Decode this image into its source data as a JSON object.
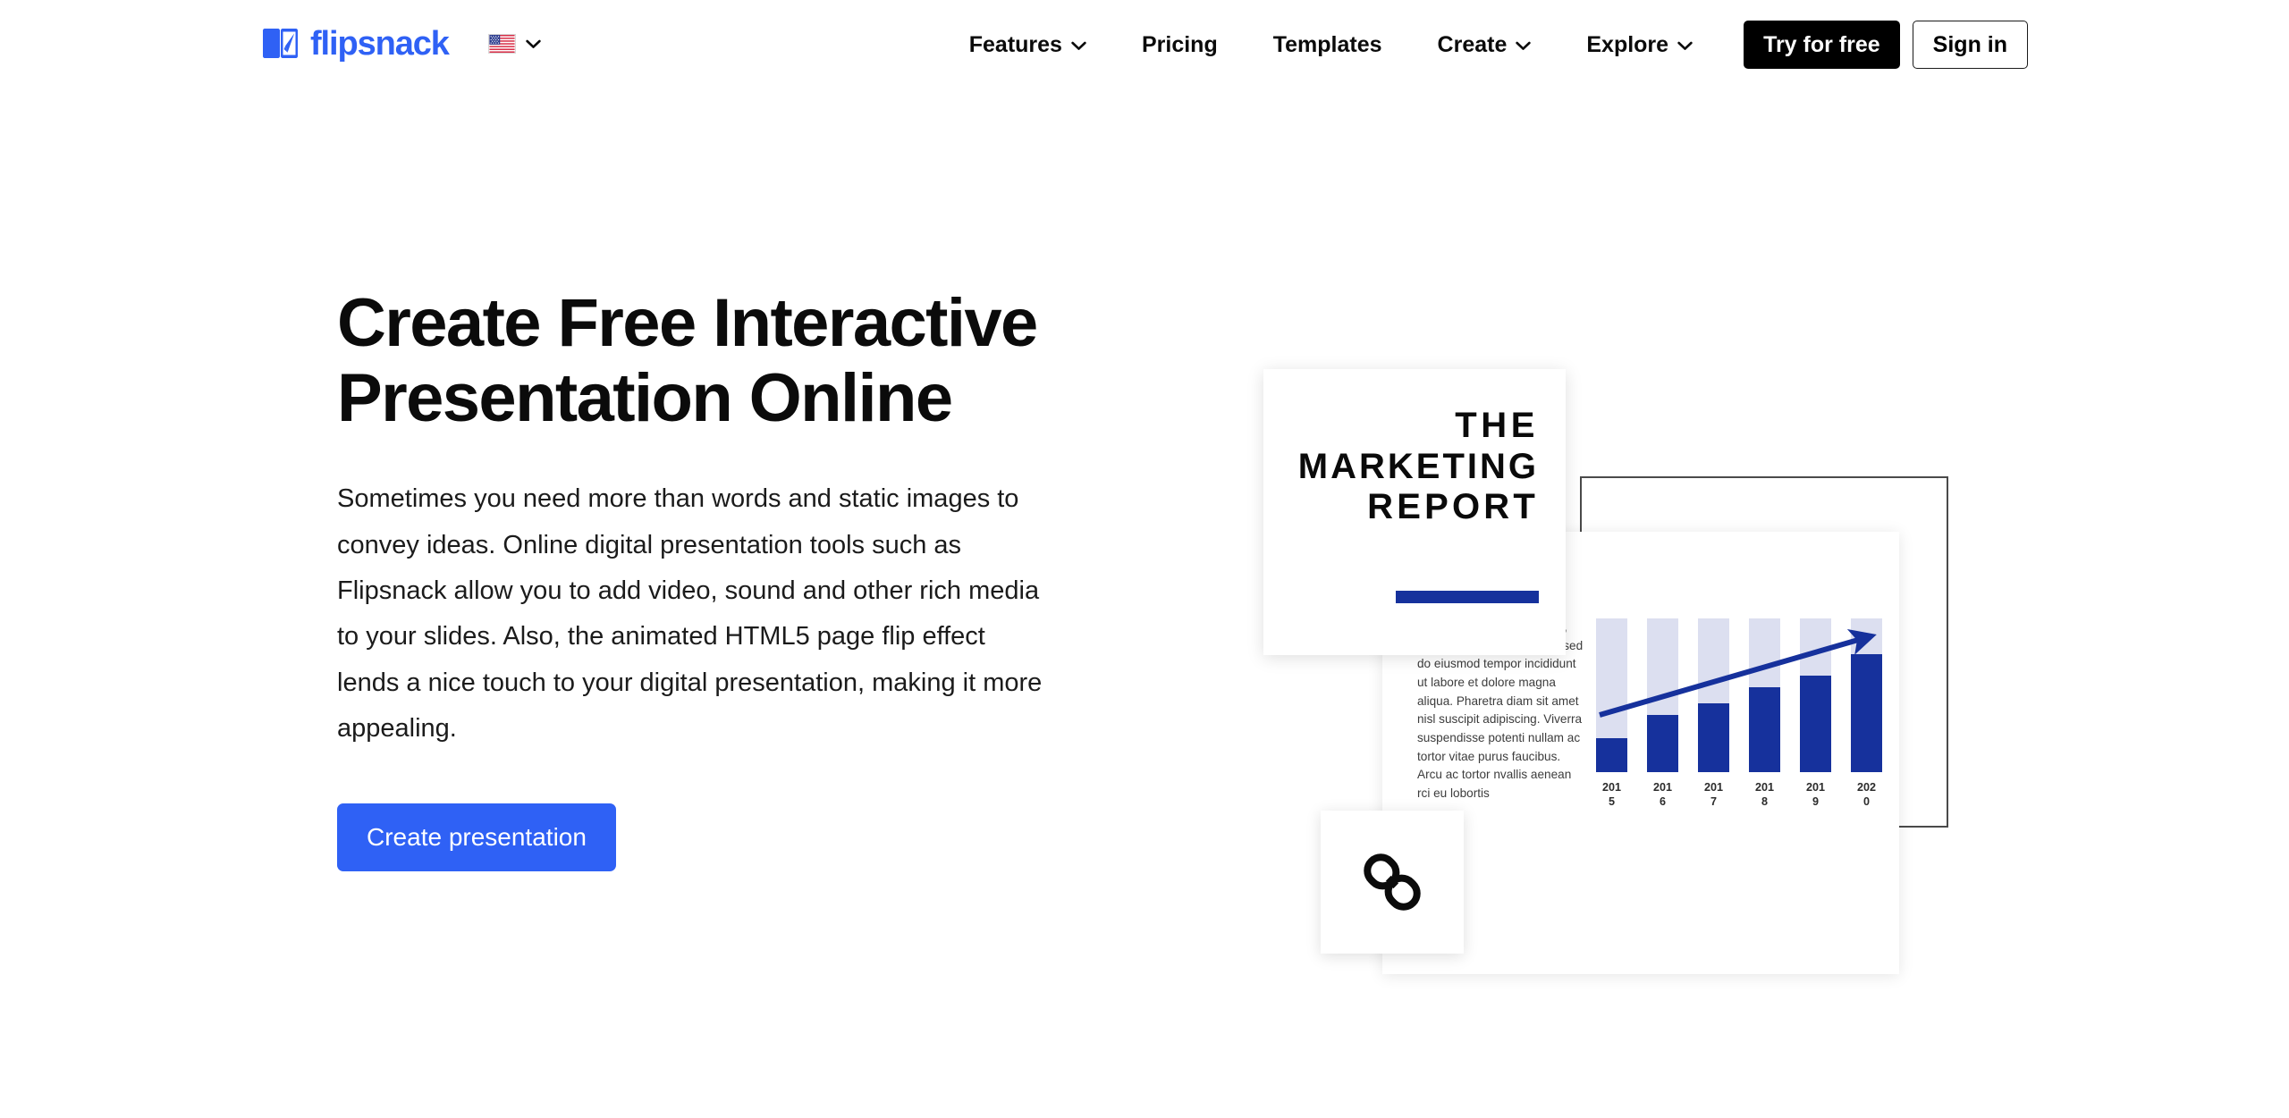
{
  "header": {
    "logo": {
      "icon": "flipsnack-book-icon",
      "wordmark": "flipsnack",
      "color": "#2f61f5"
    },
    "language_switcher": {
      "flag": "us-flag-icon",
      "chevron": "chevron-down-icon"
    },
    "nav_items": [
      {
        "label": "Features",
        "has_dropdown": true
      },
      {
        "label": "Pricing",
        "has_dropdown": false
      },
      {
        "label": "Templates",
        "has_dropdown": false
      },
      {
        "label": "Create",
        "has_dropdown": true
      },
      {
        "label": "Explore",
        "has_dropdown": true
      }
    ],
    "try_button": "Try for free",
    "signin_button": "Sign in"
  },
  "hero": {
    "title": "Create Free Interactive Presentation Online",
    "body": "Sometimes you need more than words and static images to convey ideas. Online digital presentation tools such as Flipsnack allow you to add video, sound and other rich media to your slides. Also, the animated HTML5 page flip effect lends a nice touch to your digital presentation, making it more appealing.",
    "cta_label": "Create presentation",
    "cta_color": "#2f61f5"
  },
  "illustration": {
    "title_card": {
      "line1": "THE",
      "line2": "MARKETING",
      "line3": "REPORT",
      "rule_color": "#16319c"
    },
    "link_card": {
      "icon": "chain-link-icon"
    },
    "body_text": "Lorem ipsum dolor sit amet, consectetur adipiscing elit, sed do eiusmod tempor incididunt ut labore et dolore magna aliqua. Pharetra diam sit amet nisl suscipit adipiscing. Viverra suspendisse potenti nullam ac tortor vitae purus faucibus. Arcu ac tortor nvallis aenean rci eu lobortis"
  },
  "chart_data": {
    "type": "bar",
    "title": "",
    "xlabel": "",
    "ylabel": "",
    "categories": [
      "2015",
      "2016",
      "2017",
      "2018",
      "2019",
      "2020"
    ],
    "category_lines": [
      [
        "201",
        "5"
      ],
      [
        "201",
        "6"
      ],
      [
        "201",
        "7"
      ],
      [
        "201",
        "8"
      ],
      [
        "201",
        "9"
      ],
      [
        "202",
        "0"
      ]
    ],
    "values": [
      22,
      37,
      45,
      55,
      63,
      77
    ],
    "ylim": [
      0,
      100
    ],
    "bar_color": "#16319c",
    "track_color": "#dcdff0",
    "grid": false,
    "legend": "none",
    "annotations": [
      {
        "type": "trend-arrow",
        "from": [
          0,
          38
        ],
        "to": [
          100,
          92
        ],
        "color": "#16319c"
      }
    ]
  }
}
